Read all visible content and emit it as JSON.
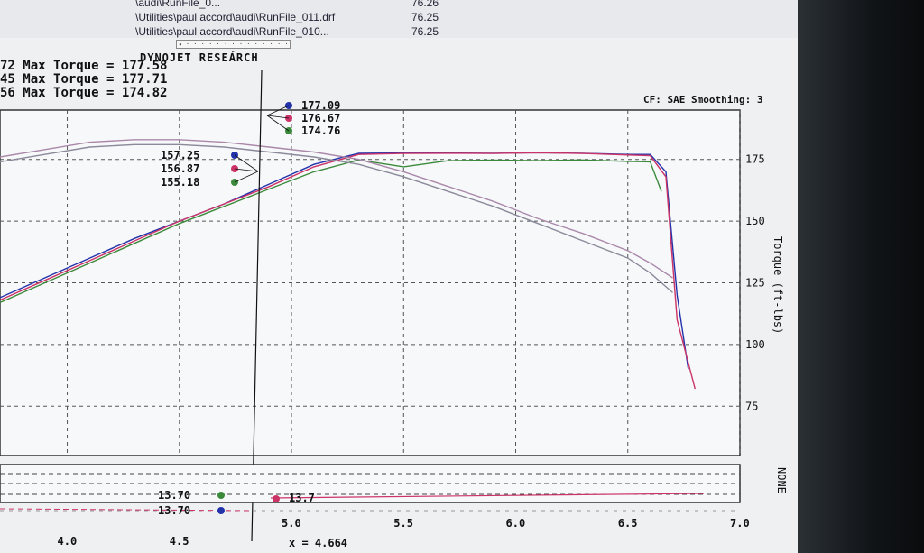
{
  "file_list": [
    {
      "path": "\\audi\\RunFile_0...",
      "value": "76.26"
    },
    {
      "path": "\\Utilities\\paul accord\\audi\\RunFile_011.drf",
      "value": "76.25"
    },
    {
      "path": "\\Utilities\\paul accord\\audi\\RunFile_010...",
      "value": "76.25"
    }
  ],
  "chart_data": {
    "type": "line",
    "title": "DYNOJET RESEARCH",
    "corner_label": "CF: SAE  Smoothing: 3",
    "ylabel": "Torque (ft-lbs)",
    "ylim": [
      55,
      195
    ],
    "xlim": [
      3.7,
      7.0
    ],
    "x_ticks": [
      "4.0",
      "4.5",
      "5.0",
      "5.5",
      "6.0",
      "6.5",
      "7.0"
    ],
    "y_ticks": [
      "175",
      "150",
      "125",
      "100",
      "75"
    ],
    "max_torque": [
      {
        "prefix": "72",
        "label": "Max Torque",
        "value": "177.58"
      },
      {
        "prefix": "45",
        "label": "Max Torque",
        "value": "177.71"
      },
      {
        "prefix": "56",
        "label": "Max Torque",
        "value": "174.82"
      }
    ],
    "series": [
      {
        "color": "#2233aa",
        "x": [
          3.7,
          3.9,
          4.1,
          4.3,
          4.5,
          4.7,
          4.9,
          5.1,
          5.3,
          5.5,
          5.7,
          5.9,
          6.1,
          6.3,
          6.5,
          6.6,
          6.67,
          6.72,
          6.77
        ],
        "y": [
          119,
          127,
          135,
          143,
          150,
          157,
          165,
          173,
          177.5,
          177.6,
          177.6,
          177.5,
          177.7,
          177.5,
          177,
          177,
          170,
          120,
          90
        ]
      },
      {
        "color": "#cc3366",
        "x": [
          3.7,
          3.9,
          4.1,
          4.3,
          4.5,
          4.7,
          4.9,
          5.1,
          5.3,
          5.5,
          5.7,
          5.9,
          6.1,
          6.3,
          6.5,
          6.6,
          6.67,
          6.72,
          6.8
        ],
        "y": [
          118,
          126,
          134,
          142,
          150,
          157,
          164,
          172,
          177,
          177.4,
          177.5,
          177.4,
          177.7,
          177.4,
          176.8,
          176.5,
          168,
          110,
          82
        ]
      },
      {
        "color": "#3b8a3b",
        "x": [
          3.7,
          3.9,
          4.1,
          4.3,
          4.5,
          4.7,
          4.9,
          5.1,
          5.3,
          5.5,
          5.7,
          5.9,
          6.1,
          6.3,
          6.5,
          6.6,
          6.65
        ],
        "y": [
          117,
          125,
          133,
          141,
          149,
          156,
          163,
          170,
          174.8,
          172,
          174.5,
          174.7,
          174.5,
          174.8,
          174.2,
          174,
          162
        ]
      },
      {
        "color": "#aa88aa",
        "x": [
          3.7,
          3.9,
          4.1,
          4.3,
          4.5,
          4.7,
          4.9,
          5.1,
          5.3,
          5.5,
          5.7,
          5.9,
          6.1,
          6.3,
          6.5,
          6.6,
          6.7
        ],
        "y": [
          176,
          179,
          182,
          183,
          183,
          182,
          180,
          178,
          175,
          170,
          164,
          158,
          151,
          145,
          138,
          133,
          127
        ]
      },
      {
        "color": "#8a8a9a",
        "x": [
          3.7,
          3.9,
          4.1,
          4.3,
          4.5,
          4.7,
          4.9,
          5.1,
          5.3,
          5.5,
          5.7,
          5.9,
          6.1,
          6.3,
          6.5,
          6.6,
          6.7
        ],
        "y": [
          174,
          177,
          180,
          181,
          181,
          180,
          178,
          176,
          173,
          168,
          162,
          156,
          149,
          142,
          135,
          129,
          121
        ]
      }
    ],
    "cursor": {
      "x": "4.664",
      "upper_values": [
        {
          "value": "177.09",
          "color": "#2233aa"
        },
        {
          "value": "176.67",
          "color": "#cc3366"
        },
        {
          "value": "174.76",
          "color": "#3b8a3b"
        }
      ],
      "lower_values": [
        {
          "value": "157.25",
          "color": "#2233aa"
        },
        {
          "value": "156.87",
          "color": "#cc3366"
        },
        {
          "value": "155.18",
          "color": "#3b8a3b"
        }
      ]
    },
    "sub_panel": {
      "label": "NONE",
      "values": [
        {
          "value": "13.70",
          "color": "#3b8a3b"
        },
        {
          "value": "13.70",
          "color": "#2233aa"
        },
        {
          "value": "13.7",
          "color": "#cc3366"
        }
      ]
    }
  }
}
